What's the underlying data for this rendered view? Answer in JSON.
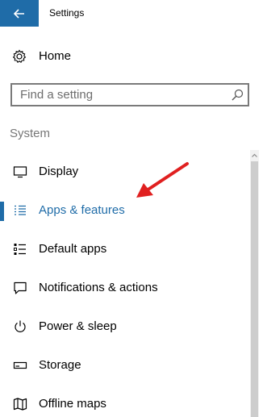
{
  "window": {
    "title": "Settings"
  },
  "home": {
    "label": "Home"
  },
  "search": {
    "placeholder": "Find a setting"
  },
  "section": {
    "label": "System"
  },
  "nav": {
    "items": [
      {
        "label": "Display",
        "icon": "display-icon",
        "active": false
      },
      {
        "label": "Apps & features",
        "icon": "apps-list-icon",
        "active": true
      },
      {
        "label": "Default apps",
        "icon": "default-apps-icon",
        "active": false
      },
      {
        "label": "Notifications & actions",
        "icon": "notifications-icon",
        "active": false
      },
      {
        "label": "Power & sleep",
        "icon": "power-icon",
        "active": false
      },
      {
        "label": "Storage",
        "icon": "storage-icon",
        "active": false
      },
      {
        "label": "Offline maps",
        "icon": "map-icon",
        "active": false
      }
    ]
  },
  "colors": {
    "accent": "#1f6ca8",
    "annotation_arrow": "#e02020"
  }
}
